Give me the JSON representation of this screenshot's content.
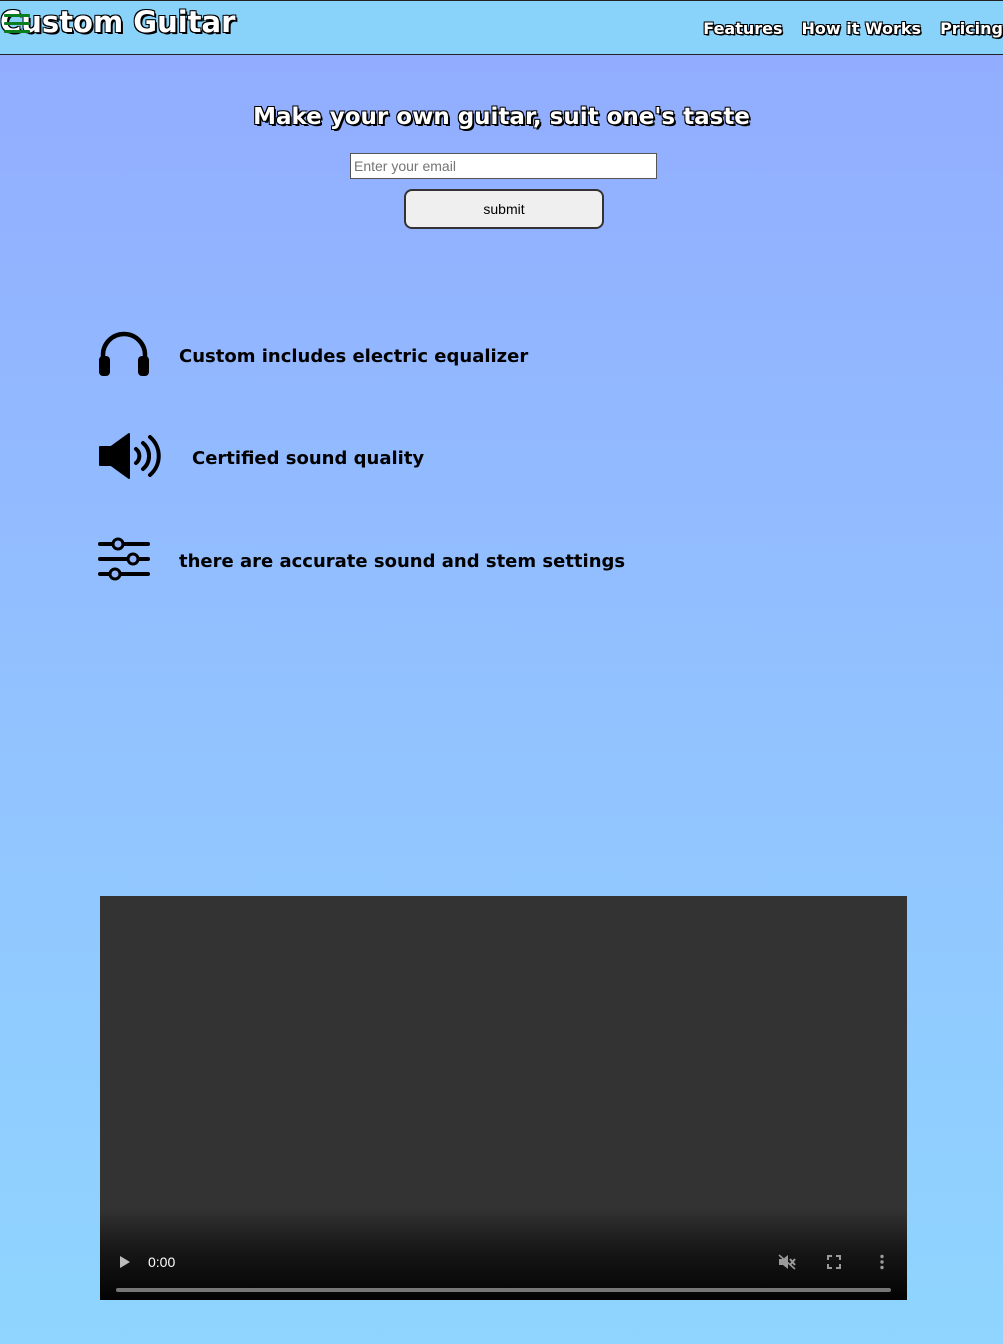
{
  "header": {
    "logo_text": "Custom Guitar",
    "menu_icon": "hamburger-menu-icon",
    "nav": [
      {
        "label": "Features"
      },
      {
        "label": "How it Works"
      },
      {
        "label": "Pricing"
      }
    ]
  },
  "hero": {
    "title": "Make your own guitar, suit one's taste",
    "email_placeholder": "Enter your email",
    "email_value": "",
    "submit_label": "submit"
  },
  "features": [
    {
      "icon": "headphones-icon",
      "text": "Custom includes electric equalizer"
    },
    {
      "icon": "speaker-volume-icon",
      "text": "Certified sound quality"
    },
    {
      "icon": "sliders-icon",
      "text": "there are accurate sound and stem settings"
    }
  ],
  "video": {
    "time": "0:00",
    "progress": 0,
    "muted": true
  },
  "colors": {
    "header_bg": "#89d2fa",
    "page_gradient_top": "#92abff",
    "page_gradient_bottom": "#8fd5ff",
    "menu_icon": "#0a7d1e",
    "video_bg": "#333333"
  }
}
